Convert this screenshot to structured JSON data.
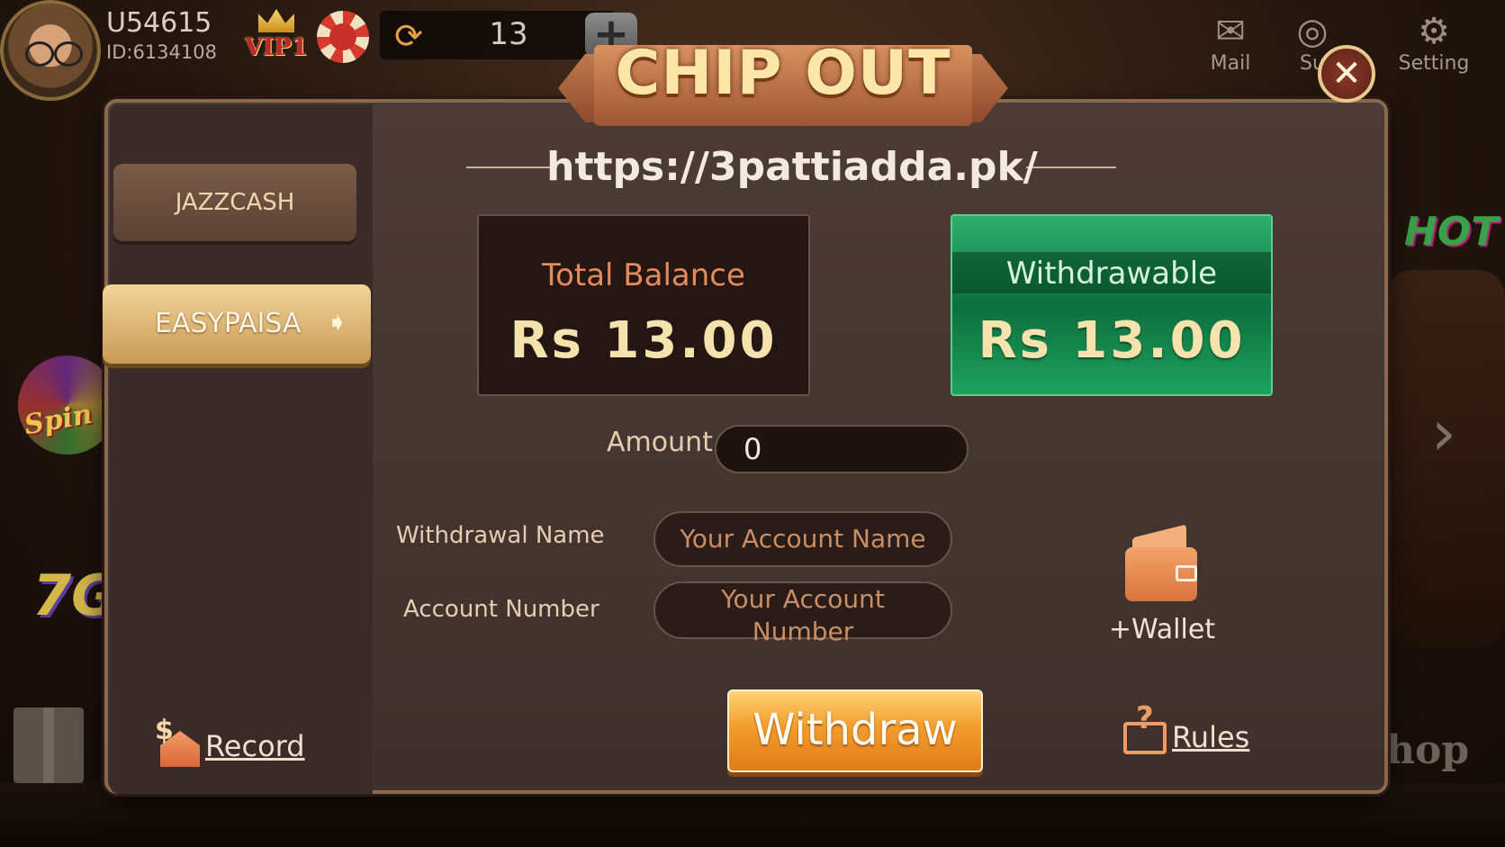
{
  "profile": {
    "username": "U54615",
    "user_id": "ID:6134108",
    "vip_label": "VIP1"
  },
  "topbar": {
    "coin_count": "13",
    "add_symbol": "+",
    "mail_label": "Mail",
    "support_label": "Su",
    "setting_label": "Setting"
  },
  "decor": {
    "spin_text": "Spin Whee",
    "game7_text": "7G",
    "hot_text": "HOT",
    "shop_text": "hop"
  },
  "dialog": {
    "title": "CHIP OUT",
    "close_symbol": "✕",
    "site_url": "https://3pattiadda.pk/"
  },
  "sidebar": {
    "tabs": [
      {
        "label": "JAZZCASH",
        "selected": false
      },
      {
        "label": "EASYPAISA",
        "selected": true
      }
    ]
  },
  "balances": {
    "total_label": "Total Balance",
    "total_value": "Rs 13.00",
    "withdrawable_label": "Withdrawable",
    "withdrawable_value": "Rs 13.00"
  },
  "form": {
    "amount_label": "Amount",
    "amount_value": "0",
    "name_label": "Withdrawal Name",
    "name_placeholder": "Your Account Name",
    "number_label": "Account Number",
    "number_placeholder": "Your Account Number"
  },
  "actions": {
    "wallet_label": "+Wallet",
    "record_label": "Record",
    "withdraw_label": "Withdraw",
    "rules_label": "Rules"
  },
  "colors": {
    "panel": "#4c3b36",
    "accent_orange": "#f29d2c",
    "withdrawable_green": "#15884e",
    "label_orange": "#e58a5a",
    "value_gold": "#f6e2ad"
  }
}
